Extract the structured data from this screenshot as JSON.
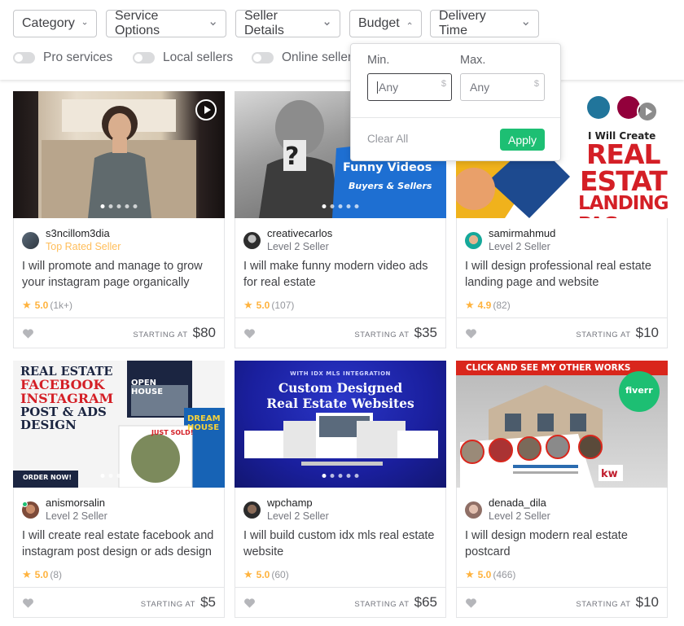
{
  "filters": {
    "category": "Category",
    "service_options": "Service Options",
    "seller_details": "Seller Details",
    "budget": "Budget",
    "delivery_time": "Delivery Time"
  },
  "toggles": {
    "pro_services": "Pro services",
    "local_sellers": "Local sellers",
    "online_sellers": "Online sellers"
  },
  "budget_popup": {
    "min_label": "Min.",
    "max_label": "Max.",
    "min_placeholder": "Any",
    "max_placeholder": "Any",
    "currency": "$",
    "clear_all": "Clear All",
    "apply": "Apply"
  },
  "starting_at": "STARTING AT",
  "gigs": [
    {
      "seller": "s3ncillom3dia",
      "level": "Top Rated Seller",
      "title": "I will promote and manage to grow your instagram page organically",
      "rating": "5.0",
      "count": "(1k+)",
      "price": "$80"
    },
    {
      "seller": "creativecarlos",
      "level": "Level 2 Seller",
      "title": "I will make funny modern video ads for real estate",
      "rating": "5.0",
      "count": "(107)",
      "price": "$35",
      "thumb_text": [
        "Funny Videos",
        "Buyers & Sellers"
      ]
    },
    {
      "seller": "samirmahmud",
      "level": "Level 2 Seller",
      "title": "I will design professional real estate landing page and website",
      "rating": "4.9",
      "count": "(82)",
      "price": "$10",
      "thumb_text": [
        "I Will Create",
        "REAL",
        "ESTAT",
        "LANDING PAG"
      ]
    },
    {
      "seller": "anismorsalin",
      "level": "Level 2 Seller",
      "title": "I will create real estate facebook and instagram post design or ads design",
      "rating": "5.0",
      "count": "(8)",
      "price": "$5",
      "thumb_text": [
        "REAL ESTATE",
        "FACEBOOK",
        "INSTAGRAM",
        "POST & ADS",
        "DESIGN",
        "OPEN HOUSE",
        "DREAM HOUSE",
        "JUST SOLD!",
        "ORDER NOW!"
      ]
    },
    {
      "seller": "wpchamp",
      "level": "Level 2 Seller",
      "title": "I will build custom idx mls real estate website",
      "rating": "5.0",
      "count": "(60)",
      "price": "$65",
      "thumb_text": [
        "WITH IDX MLS INTEGRATION",
        "Custom Designed",
        "Real Estate Websites"
      ]
    },
    {
      "seller": "denada_dila",
      "level": "Level 2 Seller",
      "title": "I will design modern real estate postcard",
      "rating": "5.0",
      "count": "(466)",
      "price": "$10",
      "thumb_text": [
        "CLICK AND SEE MY OTHER WORKS",
        "fiverr"
      ]
    }
  ]
}
